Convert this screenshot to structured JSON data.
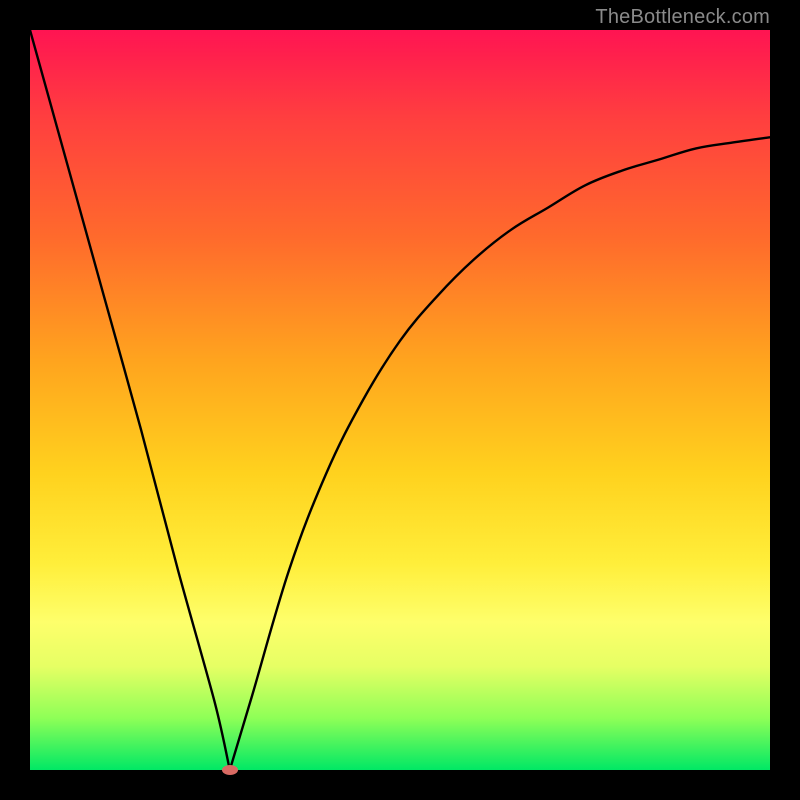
{
  "watermark": "TheBottleneck.com",
  "colors": {
    "background": "#000000",
    "curve": "#000000",
    "minpoint": "#d86a63"
  },
  "chart_data": {
    "type": "line",
    "title": "",
    "xlabel": "",
    "ylabel": "",
    "xlim": [
      0,
      100
    ],
    "ylim": [
      0,
      100
    ],
    "grid": false,
    "legend": false,
    "series": [
      {
        "name": "curve",
        "x": [
          0,
          5,
          10,
          15,
          20,
          25,
          27,
          30,
          35,
          40,
          45,
          50,
          55,
          60,
          65,
          70,
          75,
          80,
          85,
          90,
          95,
          100
        ],
        "y": [
          100,
          82,
          64,
          46,
          27,
          9,
          0,
          10,
          27,
          40,
          50,
          58,
          64,
          69,
          73,
          76,
          79,
          81,
          82.5,
          84,
          84.8,
          85.5
        ]
      }
    ],
    "annotations": [
      {
        "name": "minimum-point",
        "x": 27,
        "y": 0
      }
    ]
  }
}
